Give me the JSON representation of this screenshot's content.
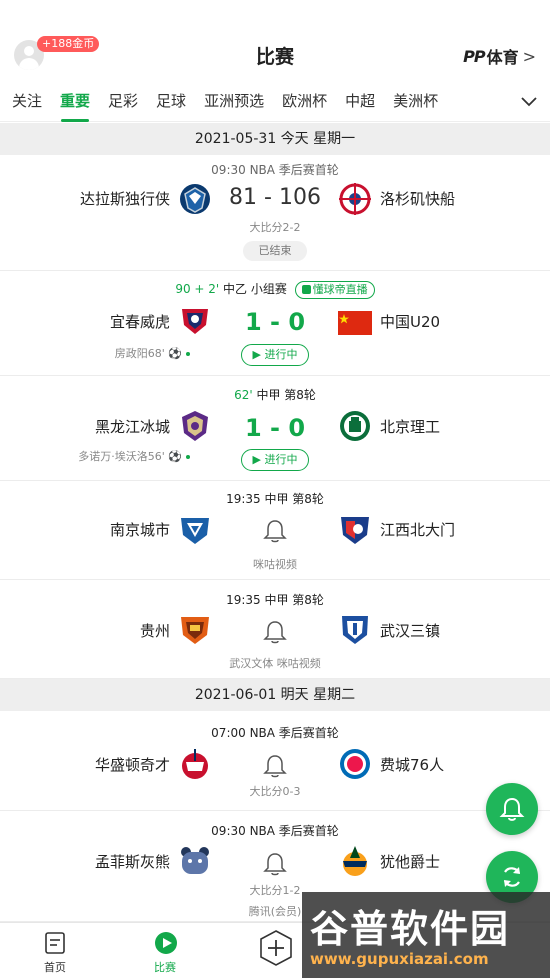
{
  "header": {
    "coin_badge": "+188金币",
    "title": "比赛",
    "brand": "PP体育",
    "brand_pp": "PP",
    "brand_text": "体育",
    "brand_chevron": ">"
  },
  "tabs": [
    "关注",
    "重要",
    "足彩",
    "足球",
    "亚洲预选",
    "欧洲杯",
    "中超",
    "美洲杯"
  ],
  "active_tab": "重要",
  "days": [
    {
      "label": "2021-05-31 今天 星期一",
      "matches": [
        {
          "meta": "09:30 NBA 季后赛首轮",
          "home": "达拉斯独行侠",
          "away": "洛杉矶快船",
          "score": "81 - 106",
          "sub": "大比分2-2",
          "status": "已结束"
        },
        {
          "meta_live": "90 + 2'",
          "meta": " 中乙 小组赛",
          "live_tag": "懂球帝直播",
          "home": "宜春威虎",
          "away": "中国U20",
          "score": "1 - 0",
          "scorer": "房政阳68'",
          "status": "进行中"
        },
        {
          "meta_live": "62'",
          "meta": " 中甲 第8轮",
          "home": "黑龙江冰城",
          "away": "北京理工",
          "score": "1 - 0",
          "scorer": "多诺万·埃沃洛56'",
          "status": "进行中"
        },
        {
          "meta": "19:35 中甲 第8轮",
          "home": "南京城市",
          "away": "江西北大门",
          "sub": "咪咕视频"
        },
        {
          "meta": "19:35 中甲 第8轮",
          "home": "贵州",
          "away": "武汉三镇",
          "sub": "武汉文体 咪咕视频"
        }
      ]
    },
    {
      "label": "2021-06-01 明天 星期二",
      "matches": [
        {
          "meta": "07:00 NBA 季后赛首轮",
          "home": "华盛顿奇才",
          "away": "费城76人",
          "sub": "大比分0-3"
        },
        {
          "meta": "09:30 NBA 季后赛首轮",
          "home": "孟菲斯灰熊",
          "away": "犹他爵士",
          "sub": "大比分1-2",
          "sub2": "腾讯(会员)"
        }
      ]
    }
  ],
  "bottom_nav": [
    {
      "label": "首页"
    },
    {
      "label": "比赛"
    },
    {
      "label": ""
    }
  ],
  "watermark": {
    "big": "谷普软件园",
    "small": "www.gupuxiazai.com"
  },
  "colors": {
    "accent": "#12a84a",
    "fab": "#1fb65a",
    "badge": "#ff5a5a",
    "day_bg": "#eeeeee"
  }
}
